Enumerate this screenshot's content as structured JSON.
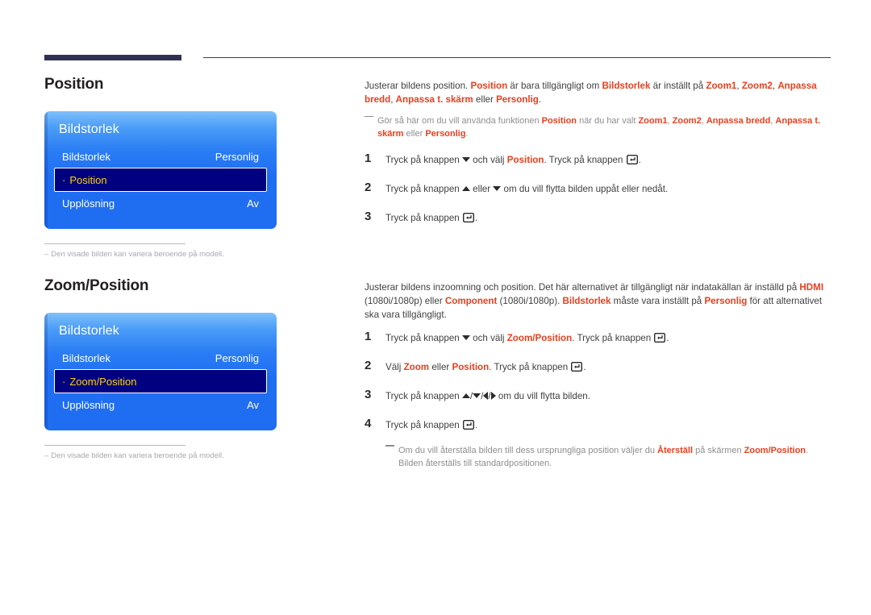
{
  "page": {
    "top_rule_present": true,
    "accent_red": "#e8401f",
    "osd_highlight_text": "#ffd400",
    "osd_blue": "#1f6ef2",
    "osd_selected_bg": "#000080"
  },
  "sections": [
    {
      "id": "position",
      "title": "Position",
      "osd": {
        "panel_title": "Bildstorlek",
        "rows": [
          {
            "label": "Bildstorlek",
            "value": "Personlig",
            "selected": false,
            "bullet": false
          },
          {
            "label": "Position",
            "value": "",
            "selected": true,
            "bullet": true
          },
          {
            "label": "Upplösning",
            "value": "Av",
            "selected": false,
            "bullet": false
          }
        ]
      },
      "caption": "Den visade bilden kan variera beroende på modell.",
      "caption_dash": "–",
      "intro": {
        "parts": [
          {
            "t": "Justerar bildens position. ",
            "s": "n"
          },
          {
            "t": "Position",
            "s": "b"
          },
          {
            "t": " är bara tillgängligt om ",
            "s": "n"
          },
          {
            "t": "Bildstorlek",
            "s": "b"
          },
          {
            "t": " är inställt på ",
            "s": "n"
          },
          {
            "t": "Zoom1",
            "s": "b"
          },
          {
            "t": ", ",
            "s": "n"
          },
          {
            "t": "Zoom2",
            "s": "b"
          },
          {
            "t": ", ",
            "s": "n"
          },
          {
            "t": "Anpassa bredd",
            "s": "b"
          },
          {
            "t": ", ",
            "s": "n"
          },
          {
            "t": "Anpassa t. skärm",
            "s": "b"
          },
          {
            "t": " eller ",
            "s": "n"
          },
          {
            "t": "Personlig",
            "s": "b"
          },
          {
            "t": ".",
            "s": "n"
          }
        ]
      },
      "note": {
        "parts": [
          {
            "t": "Gör så här om du vill använda funktionen ",
            "s": "n"
          },
          {
            "t": "Position",
            "s": "b"
          },
          {
            "t": " när du har valt ",
            "s": "n"
          },
          {
            "t": "Zoom1",
            "s": "b"
          },
          {
            "t": ", ",
            "s": "n"
          },
          {
            "t": "Zoom2",
            "s": "b"
          },
          {
            "t": ", ",
            "s": "n"
          },
          {
            "t": "Anpassa bredd",
            "s": "b"
          },
          {
            "t": ", ",
            "s": "n"
          },
          {
            "t": "Anpassa t. skärm",
            "s": "b"
          },
          {
            "t": " eller ",
            "s": "n"
          },
          {
            "t": "Personlig",
            "s": "b"
          },
          {
            "t": ".",
            "s": "n"
          }
        ]
      },
      "steps": [
        {
          "num": "1",
          "parts": [
            {
              "t": "Tryck på knappen ",
              "s": "n"
            },
            {
              "t": "",
              "s": "icon",
              "icon": "triangle-down-icon"
            },
            {
              "t": " och välj ",
              "s": "n"
            },
            {
              "t": "Position",
              "s": "b"
            },
            {
              "t": ". Tryck på knappen ",
              "s": "n"
            },
            {
              "t": "",
              "s": "icon",
              "icon": "enter-key-icon"
            },
            {
              "t": ".",
              "s": "n"
            }
          ]
        },
        {
          "num": "2",
          "parts": [
            {
              "t": "Tryck på knappen ",
              "s": "n"
            },
            {
              "t": "",
              "s": "icon",
              "icon": "triangle-up-icon"
            },
            {
              "t": " eller ",
              "s": "n"
            },
            {
              "t": "",
              "s": "icon",
              "icon": "triangle-down-icon"
            },
            {
              "t": " om du vill flytta bilden uppåt eller nedåt.",
              "s": "n"
            }
          ]
        },
        {
          "num": "3",
          "parts": [
            {
              "t": "Tryck på knappen ",
              "s": "n"
            },
            {
              "t": "",
              "s": "icon",
              "icon": "enter-key-icon"
            },
            {
              "t": ".",
              "s": "n"
            }
          ]
        }
      ]
    },
    {
      "id": "zoomposition",
      "title": "Zoom/Position",
      "osd": {
        "panel_title": "Bildstorlek",
        "rows": [
          {
            "label": "Bildstorlek",
            "value": "Personlig",
            "selected": false,
            "bullet": false
          },
          {
            "label": "Zoom/Position",
            "value": "",
            "selected": true,
            "bullet": true
          },
          {
            "label": "Upplösning",
            "value": "Av",
            "selected": false,
            "bullet": false
          }
        ]
      },
      "caption": "Den visade bilden kan variera beroende på modell.",
      "caption_dash": "–",
      "intro": {
        "parts": [
          {
            "t": "Justerar bildens inzoomning och position. Det här alternativet är tillgängligt när indatakällan är inställd på ",
            "s": "n"
          },
          {
            "t": "HDMI",
            "s": "b"
          },
          {
            "t": " (1080i/1080p) eller ",
            "s": "n"
          },
          {
            "t": "Component",
            "s": "b"
          },
          {
            "t": " (1080i/1080p). ",
            "s": "n"
          },
          {
            "t": "Bildstorlek",
            "s": "b"
          },
          {
            "t": " måste vara inställt på ",
            "s": "n"
          },
          {
            "t": "Personlig",
            "s": "b"
          },
          {
            "t": " för att alternativet ska vara tillgängligt.",
            "s": "n"
          }
        ]
      },
      "steps": [
        {
          "num": "1",
          "parts": [
            {
              "t": "Tryck på knappen ",
              "s": "n"
            },
            {
              "t": "",
              "s": "icon",
              "icon": "triangle-down-icon"
            },
            {
              "t": " och välj ",
              "s": "n"
            },
            {
              "t": "Zoom/Position",
              "s": "b"
            },
            {
              "t": ". Tryck på knappen ",
              "s": "n"
            },
            {
              "t": "",
              "s": "icon",
              "icon": "enter-key-icon"
            },
            {
              "t": ".",
              "s": "n"
            }
          ]
        },
        {
          "num": "2",
          "parts": [
            {
              "t": "Välj ",
              "s": "n"
            },
            {
              "t": "Zoom",
              "s": "b"
            },
            {
              "t": " eller ",
              "s": "n"
            },
            {
              "t": "Position",
              "s": "b"
            },
            {
              "t": ". Tryck på knappen ",
              "s": "n"
            },
            {
              "t": "",
              "s": "icon",
              "icon": "enter-key-icon"
            },
            {
              "t": ".",
              "s": "n"
            }
          ]
        },
        {
          "num": "3",
          "parts": [
            {
              "t": "Tryck på knappen ",
              "s": "n"
            },
            {
              "t": "",
              "s": "icon",
              "icon": "triangle-up-icon"
            },
            {
              "t": "/",
              "s": "n"
            },
            {
              "t": "",
              "s": "icon",
              "icon": "triangle-down-icon"
            },
            {
              "t": "/",
              "s": "n"
            },
            {
              "t": "",
              "s": "icon",
              "icon": "triangle-left-icon"
            },
            {
              "t": "/",
              "s": "n"
            },
            {
              "t": "",
              "s": "icon",
              "icon": "triangle-right-icon"
            },
            {
              "t": " om du vill flytta bilden.",
              "s": "n"
            }
          ]
        },
        {
          "num": "4",
          "parts": [
            {
              "t": "Tryck på knappen ",
              "s": "n"
            },
            {
              "t": "",
              "s": "icon",
              "icon": "enter-key-icon"
            },
            {
              "t": ".",
              "s": "n"
            }
          ]
        }
      ],
      "footnote": {
        "parts": [
          {
            "t": "Om du vill återställa bilden till dess ursprungliga position väljer du ",
            "s": "n"
          },
          {
            "t": "Återställ",
            "s": "b"
          },
          {
            "t": " på skärmen ",
            "s": "n"
          },
          {
            "t": "Zoom/Position",
            "s": "b"
          },
          {
            "t": ". Bilden återställs till standardpositionen.",
            "s": "n"
          }
        ]
      }
    }
  ]
}
